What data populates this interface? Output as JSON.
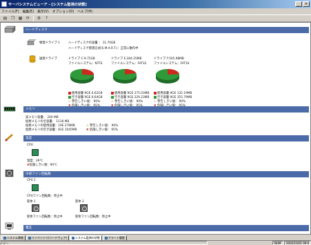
{
  "window": {
    "title": "サーバシステムビューア - [システム監視の状態]"
  },
  "menu": [
    "ファイル(F)",
    "編集(E)",
    "表示(V)",
    "オプション(O)",
    "ヘルプ(H)"
  ],
  "sections": {
    "disk": {
      "title": "ハードディスク",
      "physical_label": "物理ドライブ 1",
      "physical_size": "ハードディスクの容量 ： 11.70GB",
      "physical_part": "ハードディスク管理方式(S.M.A.R.T.)：正常に動作中",
      "logical_label": "論理ドライブ",
      "drives": [
        {
          "name": "ドライブ C:9.75GB",
          "fs": "ファイルシステム：NTFS",
          "used": "使用容量 9GE 6.62GB",
          "free": "空き容量 9GE 6.64GB",
          "warn": "警告しきい値： 90%",
          "crit": "危険しきい値： 95%",
          "used_ratio": 0.27
        },
        {
          "name": "ドライブ E:304.25MB",
          "fs": "ファイルシステム：FAT32",
          "used": "使用容量 9GE 275.03MB",
          "free": "空き容量 9GE 229.23MB",
          "warn": "警告しきい値： 90%",
          "crit": "危険しきい値： 95%",
          "used_ratio": 0.21
        },
        {
          "name": "ドライブ F:505.98MB",
          "fs": "ファイルシステム：FAT16",
          "used": "使用容量 9GE 135.19MB",
          "free": "空き容量 9GE 355.79MB",
          "warn": "警告しきい値： 90%",
          "crit": "危険しきい値： 95%",
          "used_ratio": 0.24
        }
      ]
    },
    "memory": {
      "title": "メモリ",
      "lines": [
        "実メモリ容量： 240 MB",
        "仮想メモリの全容量： 1118 MB",
        "仮想メモリの使用容量：19E 278MB",
        "仮想メモリの空き容量：81E 1045MB"
      ],
      "warn": "警告しきい値： 90%",
      "crit": "危険しきい値： 95%"
    },
    "temperature": {
      "title": "温度",
      "cpu_label": "CPU",
      "value": "温度：39℃",
      "crit": "危険しきい値：90℃"
    },
    "fan": {
      "title": "冷却ファン回転数",
      "cpu_label": "CPU 1",
      "cpu_status": "CPUファン回転数：停止中",
      "case1_label": "筐体 1",
      "case2_label": "筐体 2",
      "case1_status": "筐体ファン回転数：停止中",
      "case2_status": "筐体ファン回転数：停止中"
    },
    "voltage": {
      "title": "電圧"
    }
  },
  "tabs": [
    "システム情報",
    "インベントリ(ハードウェア)",
    "システム監視の状態",
    "アラート履歴"
  ],
  "status": {
    "left": "ﾚﾃﾞｨ",
    "num": "NUM",
    "datetime": "2002/10/01 09:0"
  },
  "colors": {
    "used": "#cc2a1e",
    "free": "#2f9a3a",
    "header": "#4a6aa8"
  }
}
